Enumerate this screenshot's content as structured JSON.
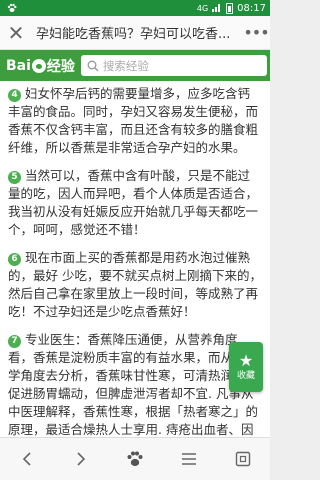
{
  "status_bar": {
    "time": "08:17",
    "network": "4G"
  },
  "title_bar": {
    "title": "孕妇能吃香蕉吗？孕妇可以吃香..."
  },
  "header": {
    "logo_left": "Bai",
    "logo_right": "经验",
    "search_placeholder": "搜索经验"
  },
  "content": {
    "items": [
      {
        "num": "4",
        "text": "妇女怀孕后钙的需要量增多，应多吃含钙丰富的食品。同时，孕妇又容易发生便秘，而香蕉不仅含钙丰富，而且还含有较多的膳食粗纤维，所以香蕉是非常适合孕产妇的水果。"
      },
      {
        "num": "5",
        "text": "当然可以，香蕉中含有叶酸，只是不能过量的吃，因人而异吧，看个人体质是否适合，我当初从没有妊娠反应开始就几乎每天都吃一个，呵呵，感觉还不错！"
      },
      {
        "num": "6",
        "text": "现在市面上买的香蕉都是用药水泡过催熟的，最好 少吃，要不就买点树上刚摘下来的，然后自己拿在家里放上一段时间，等成熟了再吃！不过孕妇还是少吃点香蕉好！"
      },
      {
        "num": "7",
        "text": "专业医生：香蕉降压通便，从营养角度看，香蕉是淀粉质丰富的有益水果，而从中医学角度去分析，香蕉味甘性寒，可清热润肠，促进肠胃蠕动，但脾虚泄泻者却不宜. 凡事从中医理解释，香蕉性寒，根据「热者寒之」的原理，最适合燥热人士享用. 痔疮出血者、因燥热而致胎动不安者，"
      }
    ]
  },
  "fav_button": {
    "label": "收藏"
  },
  "colors": {
    "status_bar": "#1f8f3c",
    "header": "#3e9e3d",
    "number_badge": "#4caf50",
    "fav_button": "#3aa84f"
  },
  "bottom_nav": {
    "icons": [
      "back-arrow-icon",
      "forward-arrow-icon",
      "baidu-paw-icon",
      "menu-icon",
      "multi-window-icon"
    ]
  }
}
